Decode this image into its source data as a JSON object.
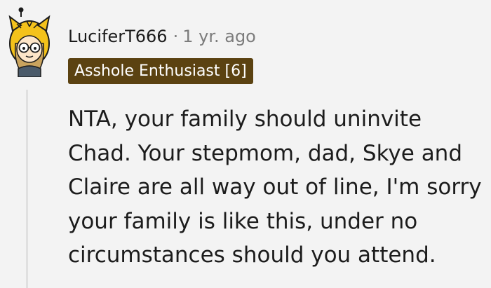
{
  "comment": {
    "username": "LuciferT666",
    "separator": "·",
    "timestamp": "1 yr. ago",
    "flair": "Asshole Enthusiast [6]",
    "body": "NTA, your family should uninvite Chad. Your stepmom, dad, Skye and Claire are all way out of line, I'm sorry your family is like this, under no circumstances should you attend."
  },
  "colors": {
    "background": "#f3f3f3",
    "text": "#1c1c1c",
    "meta": "#7c7c7c",
    "flair_bg": "#5b4211",
    "flair_text": "#ffffff",
    "thread_line": "#e0e0e0"
  },
  "icons": {
    "avatar": "snoo-avatar-icon"
  }
}
